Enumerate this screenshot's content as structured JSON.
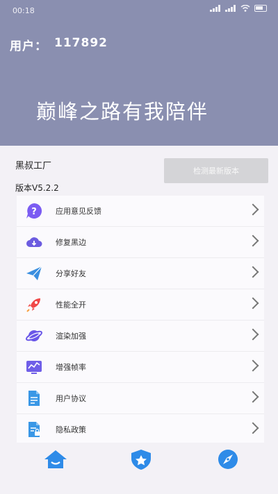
{
  "status_bar": {
    "time": "00:18"
  },
  "header": {
    "user_label": "用户：",
    "user_id": "117892",
    "slogan": "巅峰之路有我陪伴"
  },
  "app": {
    "name": "黑叔工厂",
    "version": "版本V5.2.2",
    "check_update_label": "检测最新版本"
  },
  "menu": {
    "items": [
      {
        "label": "应用意见反馈",
        "icon": "question-icon",
        "color": "#7b5cf2"
      },
      {
        "label": "修复黑边",
        "icon": "cloud-icon",
        "color": "#6c5ce0"
      },
      {
        "label": "分享好友",
        "icon": "paper-plane-icon",
        "color": "#3a8fe0"
      },
      {
        "label": "性能全开",
        "icon": "rocket-icon",
        "color": "#f04848"
      },
      {
        "label": "渲染加强",
        "icon": "planet-icon",
        "color": "#6a57e8"
      },
      {
        "label": "增强帧率",
        "icon": "chart-icon",
        "color": "#6f5ee8"
      },
      {
        "label": "用户协议",
        "icon": "document-icon",
        "color": "#3a97e6"
      },
      {
        "label": "隐私政策",
        "icon": "privacy-doc-icon",
        "color": "#3a97e6"
      }
    ]
  },
  "bottom_nav": {
    "items": [
      {
        "icon": "home-icon",
        "color": "#2e8be8"
      },
      {
        "icon": "shield-icon",
        "color": "#2e8be8"
      },
      {
        "icon": "compass-icon",
        "color": "#2e8be8"
      }
    ]
  }
}
